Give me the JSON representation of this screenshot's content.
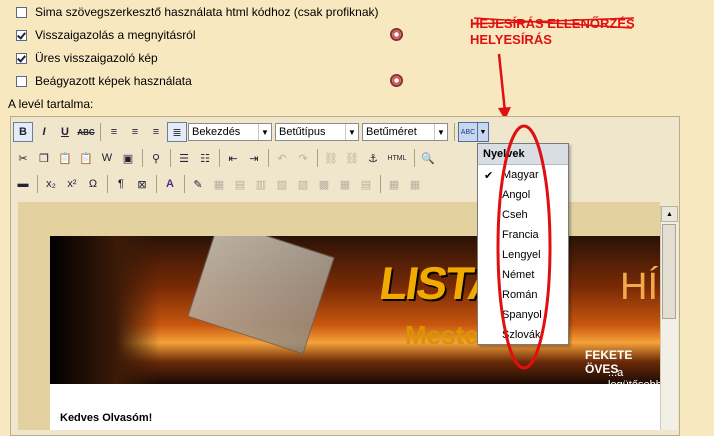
{
  "options": [
    {
      "label": "Sima szövegszerkesztő használata html kódhoz (csak profiknak)",
      "checked": false
    },
    {
      "label": "Visszaigazolás a megnyitásról",
      "checked": true
    },
    {
      "label": "Üres visszaigazoló kép",
      "checked": true
    },
    {
      "label": "Beágyazott képek használata",
      "checked": false
    }
  ],
  "content_label": "A levél tartalma:",
  "toolbar": {
    "bold": "B",
    "italic": "I",
    "underline": "U",
    "strike": "ABC",
    "format": "Bekezdés",
    "font": "Betűtípus",
    "size": "Betűméret",
    "spell_icon": "ABC",
    "html": "HTML",
    "sub": "x₂",
    "sup": "x²",
    "omega": "Ω",
    "para": "¶",
    "aa": "A"
  },
  "menu": {
    "title": "Nyelvek",
    "items": [
      "Magyar",
      "Angol",
      "Cseh",
      "Francia",
      "Lengyel",
      "Német",
      "Román",
      "Spanyol",
      "Szlovák"
    ],
    "checked_index": 0
  },
  "annotation": {
    "line1": "HEJESÍRÁS ELLENŐRZÉS",
    "line2": "HELYESÍRÁS"
  },
  "banner": {
    "logo": "LISTA",
    "logo2": "Mester",
    "right_big": "HÍ",
    "right_title": "FEKETE ÖVES",
    "right_sub": "...a legütősebb"
  },
  "document": {
    "greeting": "Kedves Olvasóm!"
  },
  "colors": {
    "annotation": "#e01010",
    "background": "#f7e8c0"
  }
}
